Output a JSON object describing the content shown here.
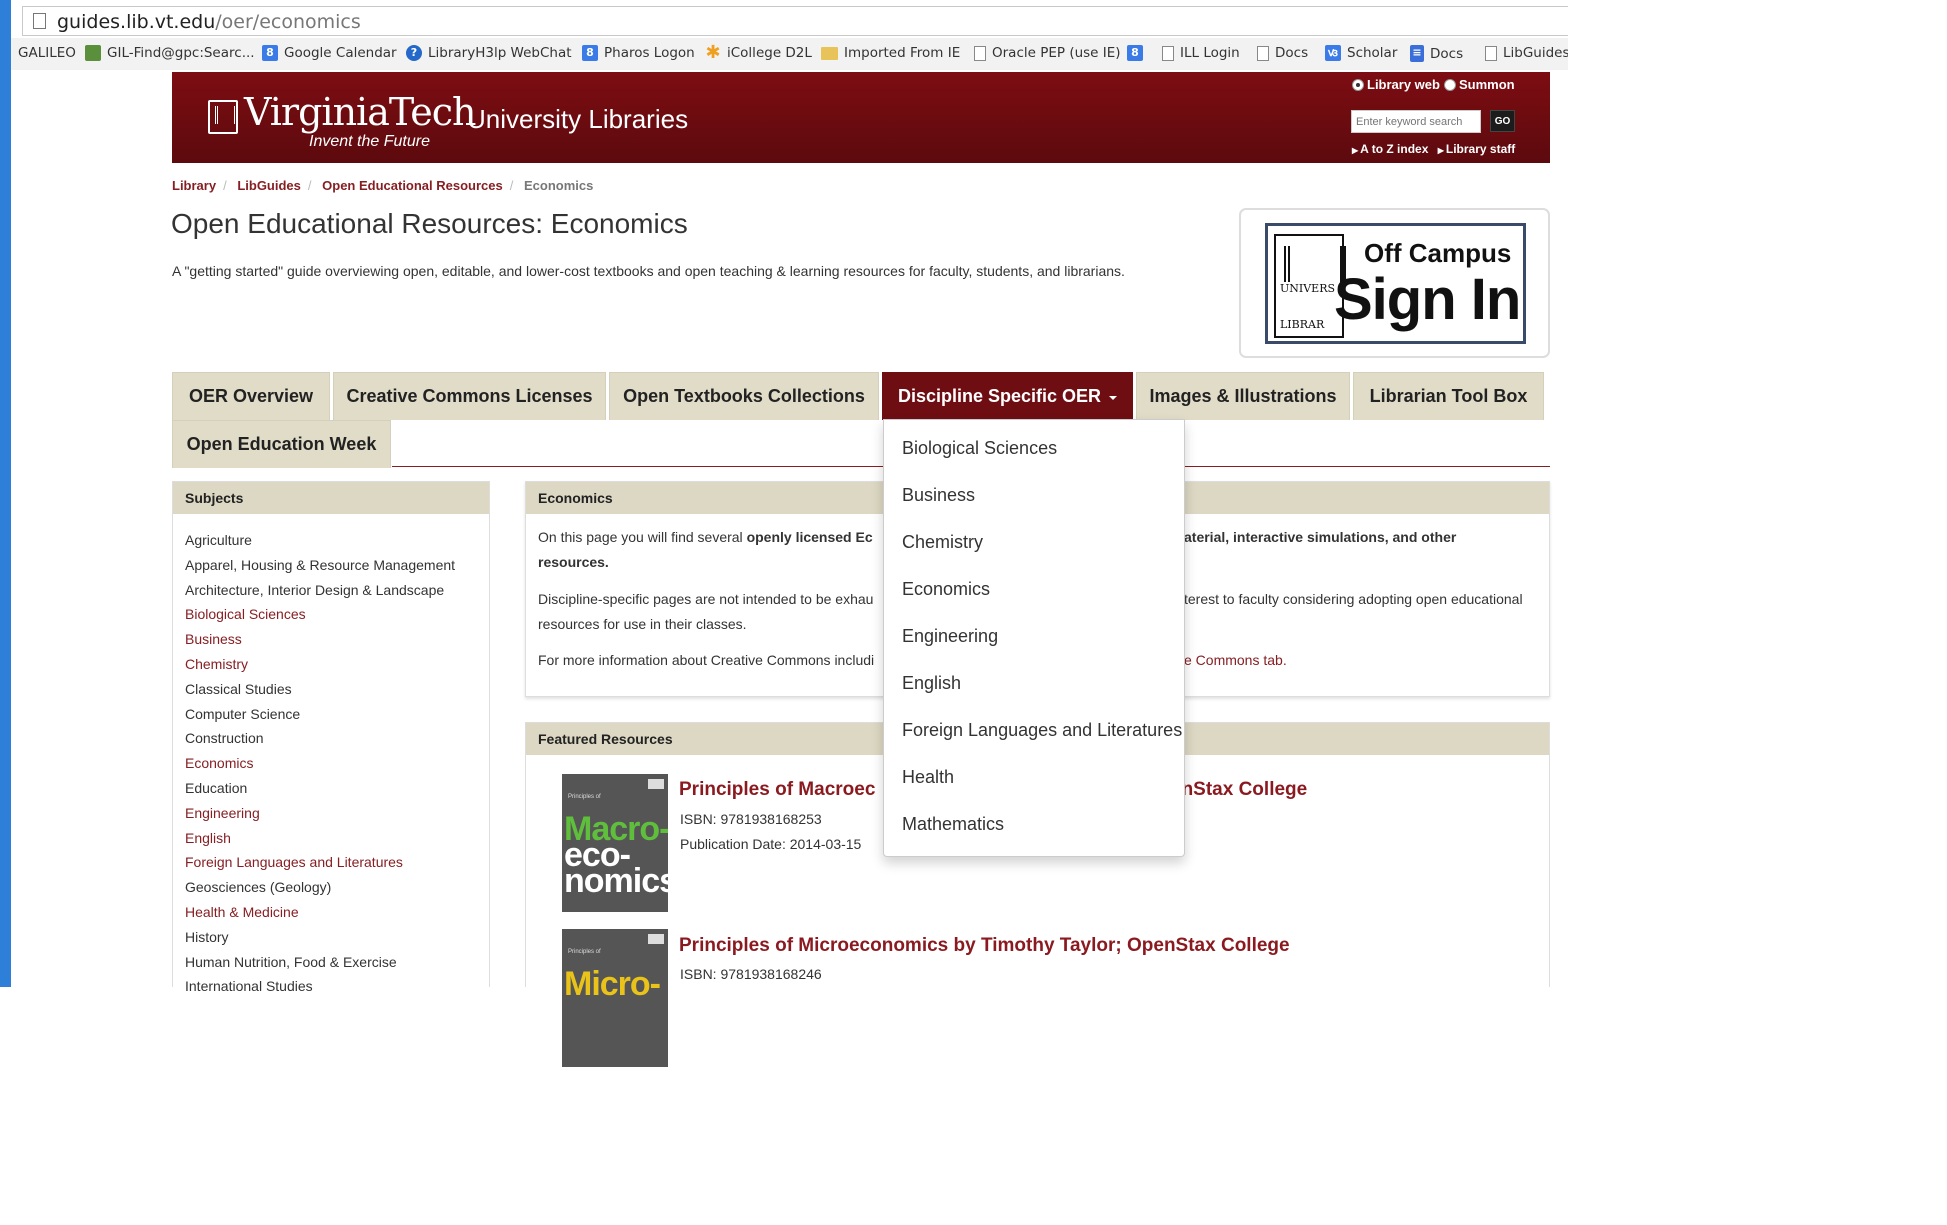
{
  "browser": {
    "url_host": "guides.lib.vt.edu",
    "url_path": "/oer/economics",
    "bookmarks": [
      {
        "label": "GALILEO",
        "icon": "none"
      },
      {
        "label": "GIL-Find@gpc:Searc...",
        "icon": "green-book-icon"
      },
      {
        "label": "Google Calendar",
        "icon": "google-icon"
      },
      {
        "label": "LibraryH3lp WebChat",
        "icon": "help-icon"
      },
      {
        "label": "Pharos Logon",
        "icon": "google-icon"
      },
      {
        "label": "iCollege D2L",
        "icon": "star-icon"
      },
      {
        "label": "Imported From IE",
        "icon": "folder-icon"
      },
      {
        "label": "Oracle PEP (use IE)",
        "icon": "page-icon"
      },
      {
        "label": "",
        "icon": "google-icon"
      },
      {
        "label": "ILL Login",
        "icon": "page-icon"
      },
      {
        "label": "Docs",
        "icon": "page-icon"
      },
      {
        "label": "Scholar",
        "icon": "scholar-icon"
      },
      {
        "label": "Docs",
        "icon": "docs-icon"
      },
      {
        "label": "LibGuides",
        "icon": "page-icon"
      }
    ]
  },
  "header": {
    "logo_word": "VirginiaTech",
    "logo_tagline": "Invent the Future",
    "site_name": "University Libraries",
    "radio_library_web": "Library web",
    "radio_summon": "Summon",
    "search_placeholder": "Enter keyword search",
    "go_label": "GO",
    "link_az": "A to Z index",
    "link_staff": "Library staff"
  },
  "breadcrumb": {
    "items": [
      "Library",
      "LibGuides",
      "Open Educational Resources"
    ],
    "current": "Economics"
  },
  "page": {
    "title": "Open Educational Resources: Economics",
    "description": "A \"getting started\" guide overviewing open, editable, and lower-cost textbooks and open teaching & learning resources for faculty, students, and librarians."
  },
  "signin": {
    "line1": "Off Campus",
    "line2": "Sign In",
    "seal_top": "UNIVERS",
    "seal_bottom": "LIBRAR"
  },
  "tabs": [
    "OER Overview",
    "Creative Commons Licenses",
    "Open Textbooks Collections",
    "Discipline Specific OER",
    "Images & Illustrations",
    "Librarian Tool Box",
    "Open Education Week"
  ],
  "dropdown": [
    "Biological Sciences",
    "Business",
    "Chemistry",
    "Economics",
    "Engineering",
    "English",
    "Foreign Languages and Literatures",
    "Health",
    "Mathematics"
  ],
  "subjects": {
    "heading": "Subjects",
    "items": [
      {
        "label": "Agriculture",
        "link": false
      },
      {
        "label": "Apparel, Housing & Resource Management",
        "link": false
      },
      {
        "label": "Architecture, Interior Design & Landscape",
        "link": false
      },
      {
        "label": "Biological Sciences",
        "link": true
      },
      {
        "label": "Business",
        "link": true
      },
      {
        "label": "Chemistry",
        "link": true
      },
      {
        "label": "Classical Studies",
        "link": false
      },
      {
        "label": "Computer Science",
        "link": false
      },
      {
        "label": "Construction",
        "link": false
      },
      {
        "label": "Economics",
        "link": true
      },
      {
        "label": "Education",
        "link": false
      },
      {
        "label": "Engineering",
        "link": true
      },
      {
        "label": "English",
        "link": true
      },
      {
        "label": "Foreign Languages and Literatures",
        "link": true
      },
      {
        "label": "Geosciences (Geology)",
        "link": false
      },
      {
        "label": "Health & Medicine",
        "link": true
      },
      {
        "label": "History",
        "link": false
      },
      {
        "label": "Human Nutrition, Food & Exercise",
        "link": false
      },
      {
        "label": "International Studies",
        "link": false
      }
    ]
  },
  "economics_box": {
    "heading": "Economics",
    "p1_start": "On this page you will find several ",
    "p1_bold": "openly licensed Ec",
    "p1_right": "aterial, interactive simulations, and other",
    "p1_line2": "resources.",
    "p2_start": "Discipline-specific pages are not intended to be exhau",
    "p2_right": "terest to faculty considering adopting open educational",
    "p2_line2": "resources for use in their classes.",
    "p3_start": "For more information about Creative Commons includi",
    "p3_right": "e Commons tab."
  },
  "featured": {
    "heading": "Featured Resources",
    "books": [
      {
        "title_left": "Principles of Macroec",
        "title_right": "enStax College",
        "isbn": "ISBN: 9781938168253",
        "pub_date": "Publication Date: 2014-03-15",
        "cover_text": [
          "Macro-",
          "eco-",
          "nomics"
        ],
        "cover_color": "#5fbf3c"
      },
      {
        "title": "Principles of Microeconomics by Timothy Taylor; OpenStax College",
        "isbn": "ISBN: 9781938168246",
        "cover_text": [
          "Micro-"
        ],
        "cover_color": "#e9c21a"
      }
    ]
  },
  "colors": {
    "brand_maroon": "#6e0e13",
    "link_maroon": "#861f23",
    "tab_tan": "#e0dcc8"
  }
}
